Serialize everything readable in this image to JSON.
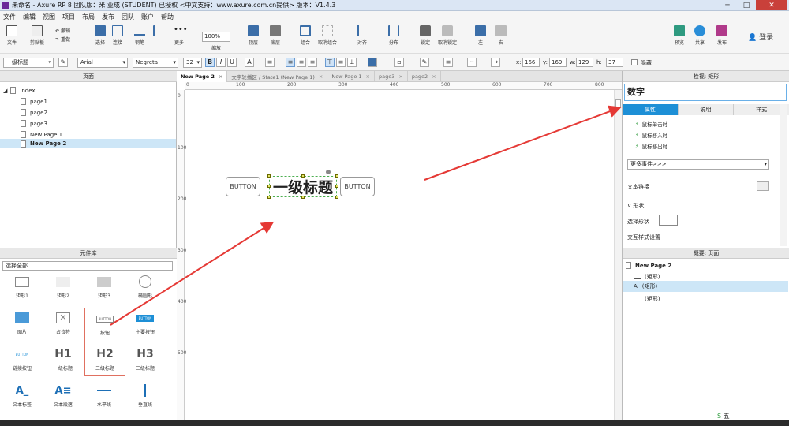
{
  "window": {
    "title": "未命名 - Axure RP 8 团队版：米 业成 (STUDENT) 已授权    <中文支持：www.axure.com.cn提供> 版本：V1.4.3"
  },
  "menu": [
    "文件",
    "编辑",
    "视图",
    "项目",
    "布局",
    "发布",
    "团队",
    "账户",
    "帮助"
  ],
  "toolbar": {
    "file": "文件",
    "clipboard": "剪贴板",
    "undo": "撤销",
    "redo": "重做",
    "select": "选择",
    "connect": "连接",
    "pen": "钢笔",
    "more": "更多",
    "zoom_value": "100%",
    "zoom": "缩放",
    "top": "顶层",
    "bottom": "底层",
    "group": "组合",
    "ungroup": "取消组合",
    "align": "对齐",
    "distribute": "分布",
    "lock": "锁定",
    "unlock": "取消锁定",
    "left": "左",
    "right": "右",
    "preview": "预览",
    "share": "共享",
    "publish": "发布",
    "login": "登录"
  },
  "format": {
    "style": "一级标题",
    "font": "Arial",
    "weight": "Negreta",
    "size": "32",
    "bold": "B",
    "italic": "I",
    "underline": "U",
    "fontcolor": "A",
    "x_label": "x:",
    "x": "166",
    "y_label": "y:",
    "y": "169",
    "w_label": "w:",
    "w": "129",
    "h_label": "h:",
    "h": "37",
    "hidden": "隐藏"
  },
  "pages_panel": {
    "title": "页面",
    "items": [
      "index",
      "page1",
      "page2",
      "page3",
      "New Page 1",
      "New Page 2"
    ]
  },
  "widget_lib": {
    "title": "元件库",
    "filter": "选择全部",
    "items": [
      "矩形1",
      "矩形2",
      "矩形3",
      "椭圆形",
      "图片",
      "占位符",
      "按钮",
      "主要按钮",
      "链接按钮",
      "一级标题",
      "二级标题",
      "三级标题",
      "文本标签",
      "文本段落",
      "水平线",
      "垂直线"
    ],
    "button_text": "BUTTON",
    "h1": "H1",
    "h2": "H2",
    "h3": "H3"
  },
  "tabs": [
    "New Page 2",
    "文字轮播区 / State1 (New Page 1)",
    "New Page 1",
    "page3",
    "page2"
  ],
  "canvas": {
    "ruler_h": [
      "0",
      "100",
      "200",
      "300",
      "400",
      "500",
      "600",
      "700",
      "800"
    ],
    "ruler_v": [
      "0",
      "100",
      "200",
      "300",
      "400",
      "500"
    ],
    "button_left": "BUTTON",
    "heading": "一级标题",
    "button_right": "BUTTON"
  },
  "inspector": {
    "title": "检视: 矩形",
    "name": "数字",
    "tabs": [
      "属性",
      "说明",
      "样式"
    ],
    "events": [
      "鼠标单击时",
      "鼠标移入时",
      "鼠标移出时"
    ],
    "more_events": "更多事件>>>",
    "text_link": "文本链接",
    "shape_section": "形状",
    "select_shape": "选择形状",
    "interaction_style": "交互样式设置"
  },
  "outline": {
    "title": "概要: 页面",
    "page": "New Page 2",
    "items": [
      "(矩形)",
      "(矩形)",
      "(矩形)"
    ]
  },
  "ime": "五"
}
